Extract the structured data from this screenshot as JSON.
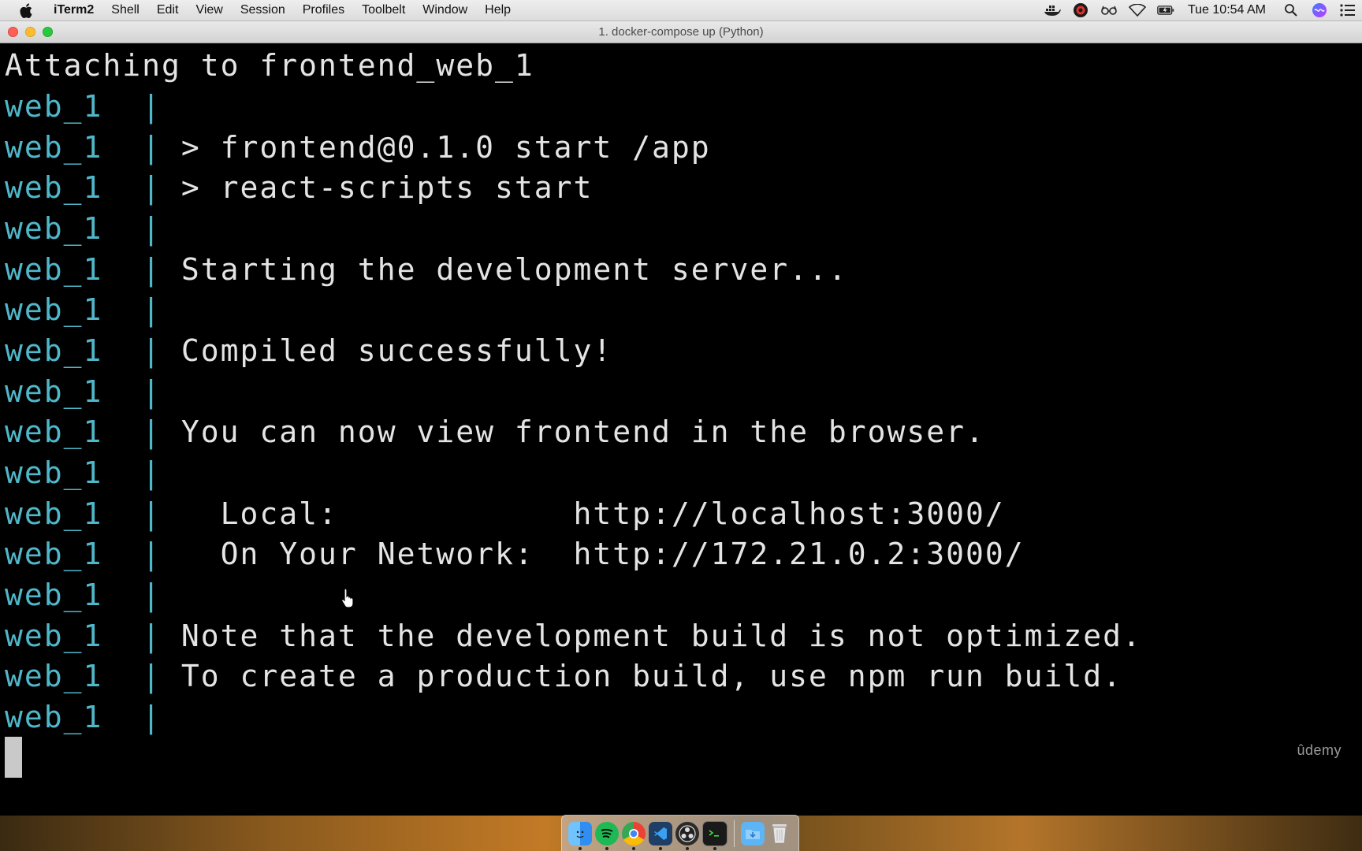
{
  "menubar": {
    "app_name": "iTerm2",
    "items": [
      "Shell",
      "Edit",
      "View",
      "Session",
      "Profiles",
      "Toolbelt",
      "Window",
      "Help"
    ],
    "clock": "Tue 10:54 AM",
    "status_icons": [
      "docker-icon",
      "creative-cloud-icon",
      "glasses-icon",
      "wifi-icon",
      "battery-icon",
      "search-icon",
      "siri-icon",
      "notification-center-icon"
    ]
  },
  "window": {
    "title": "1. docker-compose up (Python)"
  },
  "terminal": {
    "lines": [
      {
        "prefix": "",
        "text": "Attaching to frontend_web_1"
      },
      {
        "prefix": "web_1  |",
        "text": ""
      },
      {
        "prefix": "web_1  |",
        "text": " > frontend@0.1.0 start /app"
      },
      {
        "prefix": "web_1  |",
        "text": " > react-scripts start"
      },
      {
        "prefix": "web_1  |",
        "text": ""
      },
      {
        "prefix": "web_1  |",
        "text": " Starting the development server..."
      },
      {
        "prefix": "web_1  |",
        "text": ""
      },
      {
        "prefix": "web_1  |",
        "text": " Compiled successfully!"
      },
      {
        "prefix": "web_1  |",
        "text": ""
      },
      {
        "prefix": "web_1  |",
        "text": " You can now view frontend in the browser."
      },
      {
        "prefix": "web_1  |",
        "text": ""
      },
      {
        "prefix": "web_1  |",
        "text": "   Local:            http://localhost:3000/"
      },
      {
        "prefix": "web_1  |",
        "text": "   On Your Network:  http://172.21.0.2:3000/"
      },
      {
        "prefix": "web_1  |",
        "text": ""
      },
      {
        "prefix": "web_1  |",
        "text": " Note that the development build is not optimized."
      },
      {
        "prefix": "web_1  |",
        "text": " To create a production build, use npm run build."
      },
      {
        "prefix": "web_1  |",
        "text": ""
      }
    ],
    "prefix_color": "#4fb7c9",
    "text_color": "#e4e4e4"
  },
  "watermark": "ûdemy",
  "dock": {
    "apps": [
      "finder-icon",
      "spotify-icon",
      "chrome-icon",
      "vscode-icon",
      "obs-icon",
      "terminal-icon",
      "downloads-folder-icon",
      "trash-icon"
    ]
  }
}
